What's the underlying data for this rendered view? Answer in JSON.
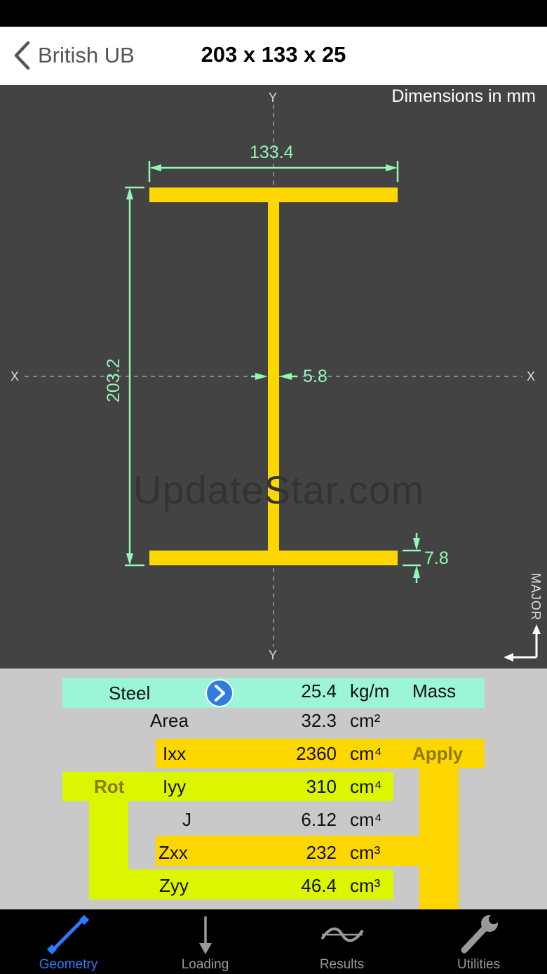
{
  "nav": {
    "back_label": "British UB",
    "title": "203 x 133 x 25"
  },
  "drawing": {
    "units_label": "Dimensions in mm",
    "axis_y_top": "Y",
    "axis_y_bottom": "Y",
    "axis_x_left": "X",
    "axis_x_right": "X",
    "width_dim": "133.4",
    "depth_dim": "203.2",
    "web_thickness_dim": "5.8",
    "flange_thickness_dim": "7.8",
    "orientation_label": "MAJOR",
    "watermark": "UpdateStar.com",
    "colors": {
      "section": "#ffd700",
      "dimension": "#93f7b6",
      "background": "#434343"
    }
  },
  "properties": {
    "material": "Steel",
    "material_chevron_icon": "chevron-right-circle-icon",
    "mass_value": "25.4",
    "mass_unit": "kg/m",
    "mass_label": "Mass",
    "area_label": "Area",
    "area_value": "32.3",
    "area_unit": "cm²",
    "ixx_label": "Ixx",
    "ixx_value": "2360",
    "ixx_unit": "cm⁴",
    "apply_label": "Apply",
    "rot_label": "Rot",
    "iyy_label": "Iyy",
    "iyy_value": "310",
    "iyy_unit": "cm⁴",
    "j_label": "J",
    "j_value": "6.12",
    "j_unit": "cm⁴",
    "zxx_label": "Zxx",
    "zxx_value": "232",
    "zxx_unit": "cm³",
    "zyy_label": "Zyy",
    "zyy_value": "46.4",
    "zyy_unit": "cm³",
    "colors": {
      "mint": "#9cf5d8",
      "orange": "#ffd700",
      "lime": "#dcf500",
      "panel": "#c9c9c9"
    }
  },
  "tabs": [
    {
      "label": "Geometry",
      "icon": "pencil-icon",
      "active": true
    },
    {
      "label": "Loading",
      "icon": "down-arrow-icon",
      "active": false
    },
    {
      "label": "Results",
      "icon": "wave-icon",
      "active": false
    },
    {
      "label": "Utilities",
      "icon": "wrench-icon",
      "active": false
    }
  ]
}
